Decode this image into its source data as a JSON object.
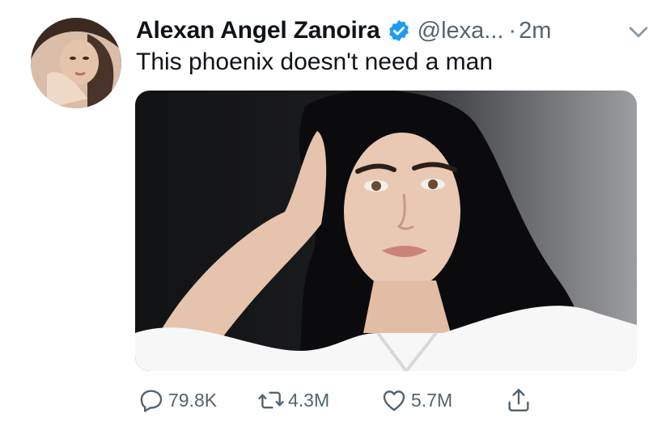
{
  "tweet": {
    "author_name": "Alexan Angel Zanoira",
    "handle": "@lexa...",
    "separator": "·",
    "time_ago": "2m",
    "text": "This phoenix doesn't need a man",
    "verified": true,
    "icons": {
      "verified": "verified-badge-icon",
      "more": "chevron-down-icon",
      "reply": "reply-icon",
      "retweet": "retweet-icon",
      "like": "heart-icon",
      "share": "share-icon"
    }
  },
  "actions": {
    "reply_count": "79.8K",
    "retweet_count": "4.3M",
    "like_count": "5.7M"
  },
  "colors": {
    "text": "#0f1419",
    "secondary": "#536471",
    "verified_blue": "#1d9bf0"
  }
}
